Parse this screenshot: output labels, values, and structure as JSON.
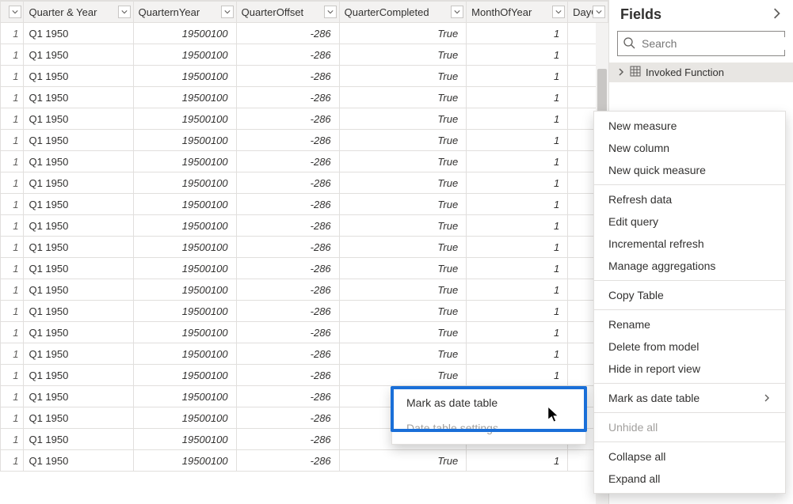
{
  "fields_pane": {
    "title": "Fields",
    "search_placeholder": "Search",
    "table_item": {
      "label": "Invoked Function"
    }
  },
  "table": {
    "columns": [
      "Quarter & Year",
      "QuarternYear",
      "QuarterOffset",
      "QuarterCompleted",
      "MonthOfYear",
      "DayOf"
    ],
    "row": {
      "idx": "1",
      "c0": "Q1 1950",
      "c1": "19500100",
      "c2": "-286",
      "c3": "True",
      "c4": "1"
    },
    "row_count": 21
  },
  "context_menu": {
    "items": [
      "New measure",
      "New column",
      "New quick measure",
      "Refresh data",
      "Edit query",
      "Incremental refresh",
      "Manage aggregations",
      "Copy Table",
      "Rename",
      "Delete from model",
      "Hide in report view",
      "Mark as date table",
      "Unhide all",
      "Collapse all",
      "Expand all"
    ],
    "disabled": [
      "Unhide all"
    ],
    "submenu_parent": "Mark as date table"
  },
  "submenu": {
    "items": [
      "Mark as date table",
      "Date table settings"
    ],
    "highlighted": "Mark as date table",
    "disabled": [
      "Date table settings"
    ]
  }
}
